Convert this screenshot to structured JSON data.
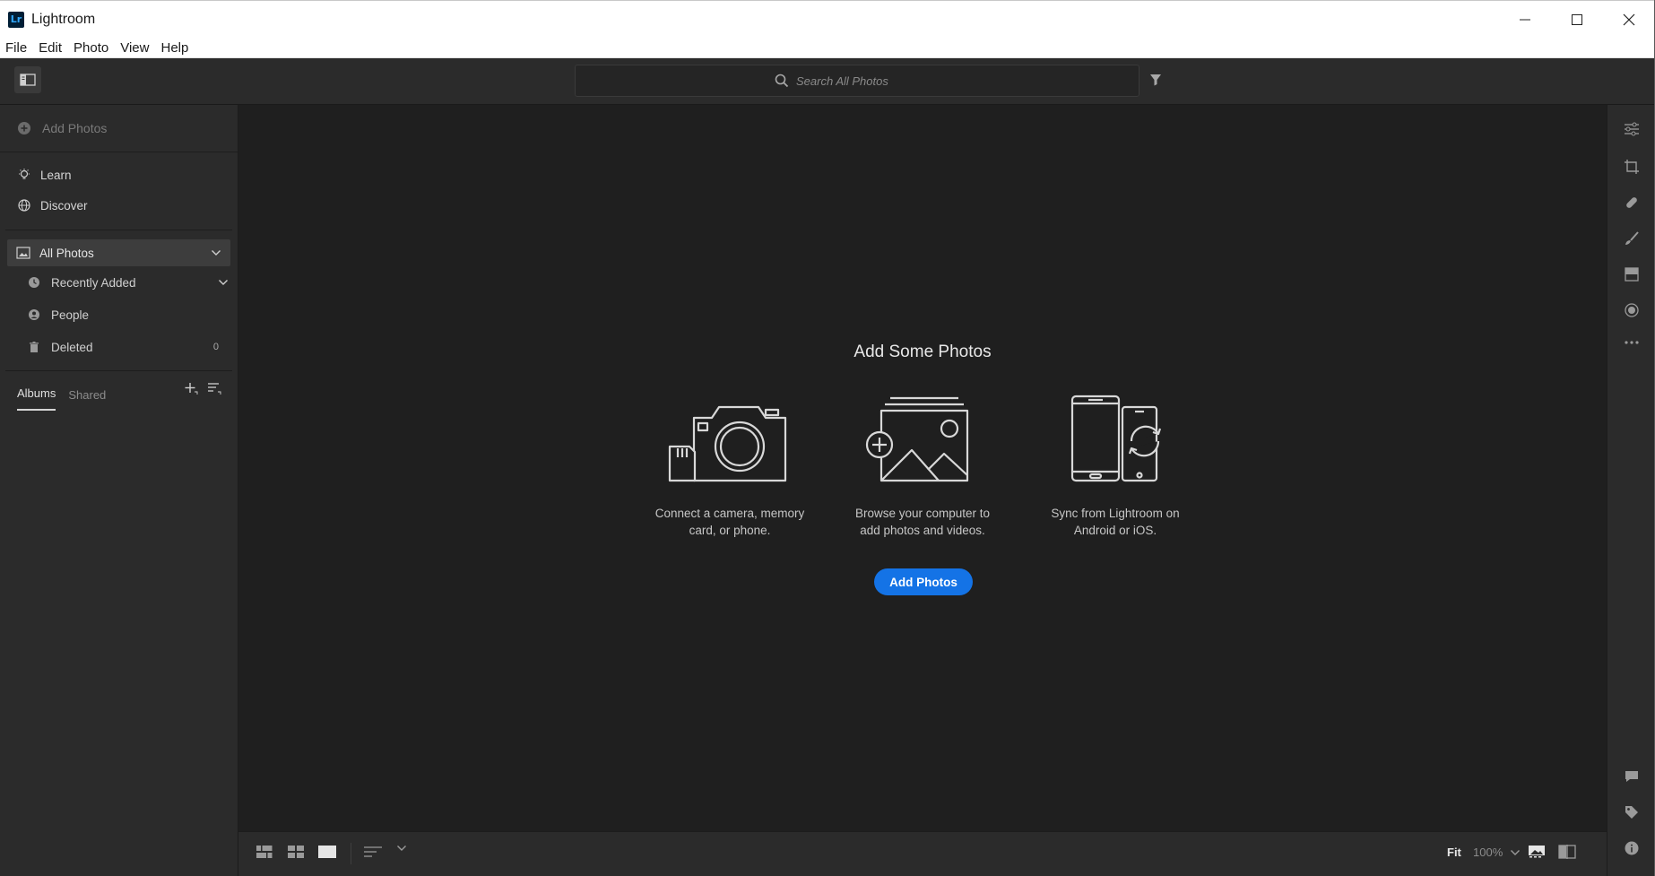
{
  "window": {
    "logo_text": "Lr",
    "title": "Lightroom"
  },
  "menu": [
    "File",
    "Edit",
    "Photo",
    "View",
    "Help"
  ],
  "search": {
    "placeholder": "Search All Photos"
  },
  "sidebar": {
    "add_photos": "Add Photos",
    "items": [
      {
        "label": "Learn",
        "icon": "lightbulb-icon"
      },
      {
        "label": "Discover",
        "icon": "globe-icon"
      }
    ],
    "all_photos": "All Photos",
    "sub_items": [
      {
        "label": "Recently Added",
        "icon": "clock-icon"
      },
      {
        "label": "People",
        "icon": "person-icon"
      },
      {
        "label": "Deleted",
        "icon": "trash-icon",
        "count": "0"
      }
    ],
    "tabs": [
      {
        "label": "Albums",
        "active": true
      },
      {
        "label": "Shared",
        "active": false
      }
    ]
  },
  "main": {
    "title": "Add Some Photos",
    "options": [
      {
        "caption_line1": "Connect a camera, memory",
        "caption_line2": "card, or phone.",
        "icon": "camera-icon"
      },
      {
        "caption_line1": "Browse your computer to",
        "caption_line2": "add photos and videos.",
        "icon": "photo-stack-icon"
      },
      {
        "caption_line1": "Sync from Lightroom on",
        "caption_line2": "Android or iOS.",
        "icon": "devices-sync-icon"
      }
    ],
    "cta_label": "Add Photos"
  },
  "bottom": {
    "fit_label": "Fit",
    "zoom_label": "100%"
  },
  "colors": {
    "accent": "#1473e6",
    "panel": "#2b2b2b",
    "canvas": "#1f1f1f"
  }
}
